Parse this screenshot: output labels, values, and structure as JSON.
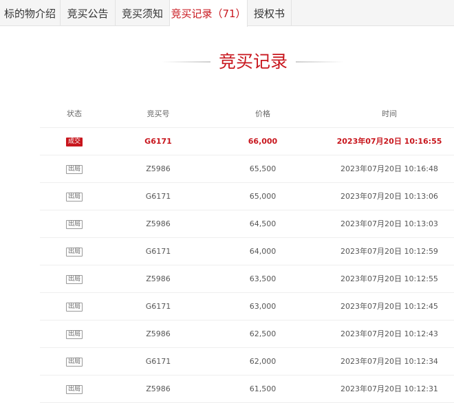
{
  "tabs": [
    {
      "label": "标的物介绍",
      "active": false
    },
    {
      "label": "竞买公告",
      "active": false
    },
    {
      "label": "竞买须知",
      "active": false
    },
    {
      "label": "竞买记录（71）",
      "active": true
    },
    {
      "label": "授权书",
      "active": false
    }
  ],
  "section": {
    "title": "竞买记录"
  },
  "table": {
    "headers": {
      "status": "状态",
      "number": "竞买号",
      "price": "价格",
      "time": "时间"
    },
    "rows": [
      {
        "status": "成交",
        "number": "G6171",
        "price": "66,000",
        "time": "2023年07月20日 10:16:55"
      },
      {
        "status": "出局",
        "number": "Z5986",
        "price": "65,500",
        "time": "2023年07月20日 10:16:48"
      },
      {
        "status": "出局",
        "number": "G6171",
        "price": "65,000",
        "time": "2023年07月20日 10:13:06"
      },
      {
        "status": "出局",
        "number": "Z5986",
        "price": "64,500",
        "time": "2023年07月20日 10:13:03"
      },
      {
        "status": "出局",
        "number": "G6171",
        "price": "64,000",
        "time": "2023年07月20日 10:12:59"
      },
      {
        "status": "出局",
        "number": "Z5986",
        "price": "63,500",
        "time": "2023年07月20日 10:12:55"
      },
      {
        "status": "出局",
        "number": "G6171",
        "price": "63,000",
        "time": "2023年07月20日 10:12:45"
      },
      {
        "status": "出局",
        "number": "Z5986",
        "price": "62,500",
        "time": "2023年07月20日 10:12:43"
      },
      {
        "status": "出局",
        "number": "G6171",
        "price": "62,000",
        "time": "2023年07月20日 10:12:34"
      },
      {
        "status": "出局",
        "number": "Z5986",
        "price": "61,500",
        "time": "2023年07月20日 10:12:31"
      }
    ]
  },
  "colors": {
    "accent": "#c8161d",
    "tab_bar": "#f5f5f5",
    "border": "#e2e2e2"
  }
}
